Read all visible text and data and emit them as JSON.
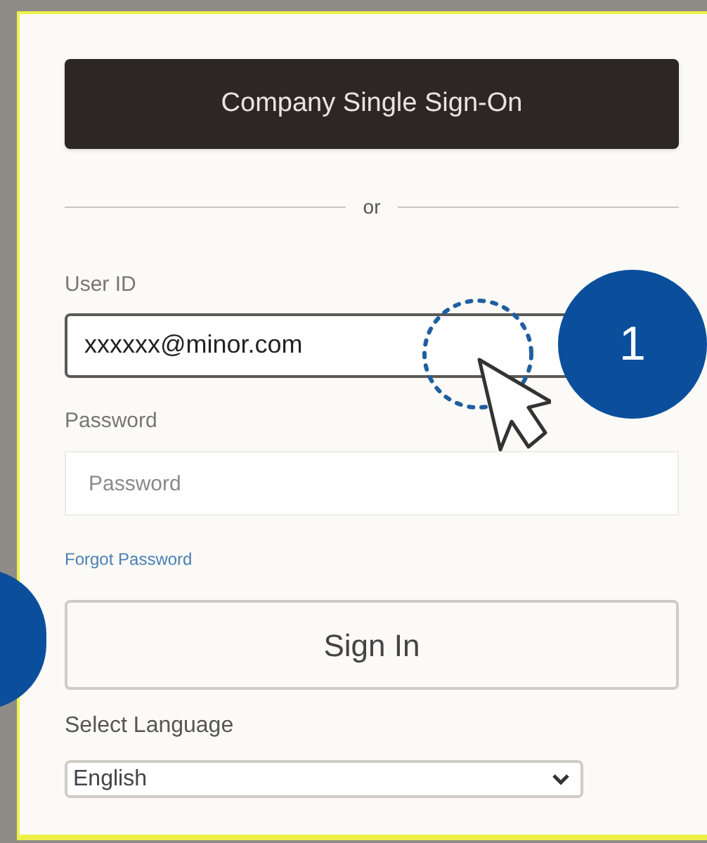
{
  "sso_button": {
    "label": "Company Single Sign-On"
  },
  "divider": {
    "label": "or"
  },
  "user_id": {
    "label": "User ID",
    "value": "xxxxxx@minor.com"
  },
  "password": {
    "label": "Password",
    "placeholder": "Password"
  },
  "forgot_link": {
    "label": "Forgot Password"
  },
  "sign_in_button": {
    "label": "Sign In"
  },
  "language": {
    "label": "Select Language",
    "value": "English"
  },
  "callouts": [
    {
      "label": "1"
    }
  ]
}
